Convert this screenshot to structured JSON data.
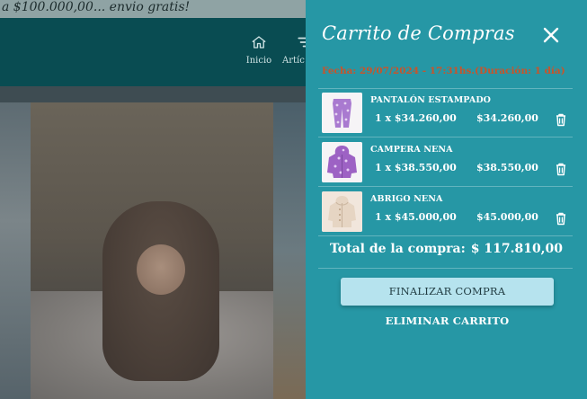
{
  "promo": {
    "text": "a $100.000,00... envio gratis!"
  },
  "nav": {
    "items": [
      {
        "label": "Inicio",
        "icon": "home-icon"
      },
      {
        "label": "Artíc",
        "icon": "filter-icon"
      }
    ]
  },
  "cart": {
    "title": "Carrito de Compras",
    "close_icon": "close-icon",
    "date_text": "Fecha: 29/07/2024 - 17:31hs.(Duración: 1 día)",
    "date_color": "#c9542a",
    "panel_color": "#2697a5",
    "items": [
      {
        "name": "PANTALÓN ESTAMPADO",
        "qty_price": "1 x $34.260,00",
        "total": "$34.260,00",
        "thumb": "purple-floral-pants"
      },
      {
        "name": "CAMPERA NENA",
        "qty_price": "1 x $38.550,00",
        "total": "$38.550,00",
        "thumb": "purple-floral-jacket"
      },
      {
        "name": "ABRIGO NENA",
        "qty_price": "1 x $45.000,00",
        "total": "$45.000,00",
        "thumb": "beige-coat"
      }
    ],
    "total_label": "Total de la compra:",
    "total_amount": "$ 117.810,00",
    "finish_button": "FINALIZAR COMPRA",
    "finish_button_color": "#b6e3ee",
    "clear_link": "ELIMINAR CARRITO"
  }
}
